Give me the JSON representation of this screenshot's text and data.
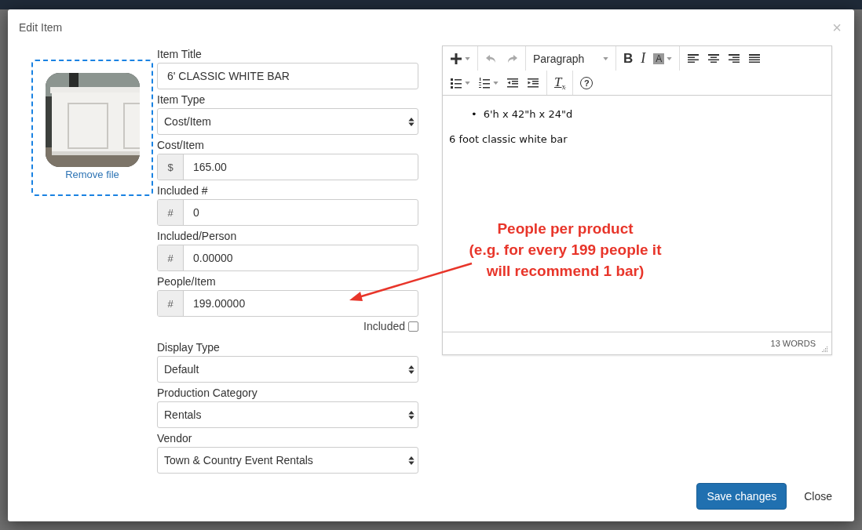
{
  "modal": {
    "title": "Edit Item",
    "close": "×"
  },
  "image_upload": {
    "remove_link": "Remove file"
  },
  "fields": [
    {
      "label": "Item Title",
      "kind": "text",
      "value": "6' CLASSIC WHITE BAR"
    },
    {
      "label": "Item Type",
      "kind": "select",
      "value": "Cost/Item"
    },
    {
      "label": "Cost/Item",
      "kind": "addon",
      "addon": "$",
      "value": "165.00"
    },
    {
      "label": "Included #",
      "kind": "addon",
      "addon": "#",
      "value": "0"
    },
    {
      "label": "Included/Person",
      "kind": "addon",
      "addon": "#",
      "value": "0.00000"
    },
    {
      "label": "People/Item",
      "kind": "addon",
      "addon": "#",
      "value": "199.00000",
      "checkbox": {
        "label": "Included",
        "checked": false
      }
    },
    {
      "label": "Display Type",
      "kind": "select",
      "value": "Default"
    },
    {
      "label": "Production Category",
      "kind": "select",
      "value": "Rentals"
    },
    {
      "label": "Vendor",
      "kind": "select",
      "value": "Town & Country Event Rentals"
    }
  ],
  "editor": {
    "toolbar": [
      [
        [
          {
            "kind": "insert",
            "dropdown": true,
            "disabled": false
          }
        ],
        [
          {
            "kind": "undo",
            "dropdown": false,
            "disabled": true
          },
          {
            "kind": "redo",
            "dropdown": false,
            "disabled": true
          }
        ],
        [
          {
            "kind": "format",
            "label": "Paragraph",
            "dropdown": true,
            "disabled": false
          }
        ],
        [
          {
            "kind": "bold",
            "label": "B",
            "dropdown": false,
            "disabled": false
          },
          {
            "kind": "italic",
            "label": "I",
            "dropdown": false,
            "disabled": false
          },
          {
            "kind": "color",
            "label": "A",
            "dropdown": true,
            "disabled": false
          }
        ],
        [
          {
            "kind": "align-left",
            "dropdown": false,
            "disabled": false
          },
          {
            "kind": "align-center",
            "dropdown": false,
            "disabled": false
          },
          {
            "kind": "align-right",
            "dropdown": false,
            "disabled": false
          },
          {
            "kind": "justify",
            "dropdown": false,
            "disabled": false
          }
        ]
      ],
      [
        [
          {
            "kind": "bullet-list",
            "dropdown": true,
            "disabled": false
          },
          {
            "kind": "number-list",
            "dropdown": true,
            "disabled": false
          },
          {
            "kind": "outdent",
            "dropdown": false,
            "disabled": false
          },
          {
            "kind": "indent",
            "dropdown": false,
            "disabled": false
          }
        ],
        [
          {
            "kind": "clear-format",
            "label": "T",
            "sub": "x",
            "dropdown": false,
            "disabled": false
          }
        ],
        [
          {
            "kind": "help",
            "label": "?",
            "dropdown": false,
            "disabled": false
          }
        ]
      ]
    ],
    "content": {
      "marker": "•",
      "bullets": [
        "6'h x 42\"h x 24\"d"
      ],
      "paragraph": "6 foot classic white bar"
    },
    "word_count": "13 WORDS"
  },
  "annotation": {
    "lines": [
      "People per product",
      "(e.g. for every 199 people it",
      "will recommend 1 bar)"
    ]
  },
  "footer": {
    "buttons": [
      {
        "label": "Save changes",
        "kind": "primary"
      },
      {
        "label": "Close",
        "kind": "plain"
      }
    ]
  }
}
